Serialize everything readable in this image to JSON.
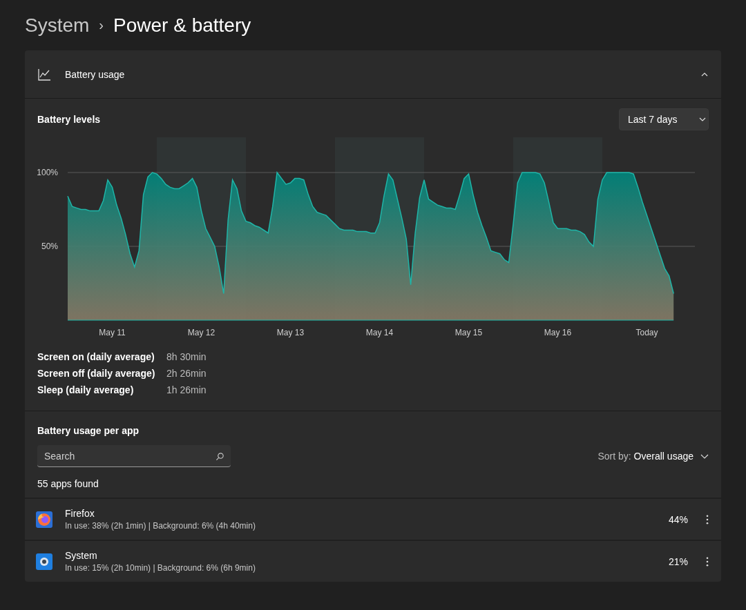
{
  "breadcrumb": {
    "parent": "System",
    "separator": "›",
    "current": "Power & battery"
  },
  "battery_usage": {
    "title": "Battery usage",
    "expanded": true,
    "levels_title": "Battery levels",
    "range_dropdown": "Last 7 days",
    "chart_data": {
      "type": "area",
      "ylim": [
        0,
        100
      ],
      "yticks": [
        {
          "value": 50,
          "label": "50%"
        },
        {
          "value": 100,
          "label": "100%"
        }
      ],
      "categories": [
        null,
        null,
        null,
        null,
        null,
        null,
        null,
        null,
        null,
        null,
        "May 11",
        null,
        null,
        null,
        null,
        null,
        null,
        null,
        null,
        null,
        null,
        null,
        null,
        null,
        null,
        null,
        null,
        null,
        null,
        null,
        "May 12",
        null,
        null,
        null,
        null,
        null,
        null,
        null,
        null,
        null,
        null,
        null,
        null,
        null,
        null,
        null,
        null,
        null,
        null,
        null,
        "May 13",
        null,
        null,
        null,
        null,
        null,
        null,
        null,
        null,
        null,
        null,
        null,
        null,
        null,
        null,
        null,
        null,
        null,
        null,
        null,
        "May 14",
        null,
        null,
        null,
        null,
        null,
        null,
        null,
        null,
        null,
        null,
        null,
        null,
        null,
        null,
        null,
        null,
        null,
        null,
        null,
        "May 15",
        null,
        null,
        null,
        null,
        null,
        null,
        null,
        null,
        null,
        null,
        null,
        null,
        null,
        null,
        null,
        null,
        null,
        null,
        null,
        "May 16",
        null,
        null,
        null,
        null,
        null,
        null,
        null,
        null,
        null,
        null,
        null,
        null,
        null,
        null,
        null,
        null,
        null,
        null,
        null,
        "Today",
        null,
        null,
        null,
        null,
        null,
        null
      ],
      "series": [
        {
          "color": "#1fb5a8",
          "values": [
            84,
            77,
            76,
            75,
            75,
            74,
            74,
            74,
            81,
            95,
            90,
            78,
            69,
            58,
            45,
            36,
            47,
            85,
            97,
            100,
            99,
            96,
            92,
            90,
            89,
            89,
            91,
            93,
            96,
            90,
            74,
            62,
            56,
            50,
            36,
            18,
            68,
            95,
            89,
            74,
            67,
            66,
            64,
            63,
            61,
            59,
            77,
            100,
            96,
            92,
            93,
            96,
            96,
            95,
            85,
            77,
            73,
            72,
            71,
            68,
            65,
            62,
            61,
            61,
            61,
            60,
            60,
            60,
            59,
            59,
            66,
            84,
            99,
            95,
            82,
            69,
            55,
            24,
            59,
            83,
            95,
            82,
            80,
            78,
            77,
            76,
            76,
            75,
            85,
            96,
            99,
            85,
            73,
            64,
            56,
            47,
            46,
            45,
            41,
            39,
            65,
            93,
            100,
            100,
            100,
            100,
            99,
            93,
            80,
            66,
            62,
            62,
            62,
            61,
            61,
            60,
            58,
            53,
            50,
            82,
            95,
            100,
            100,
            100,
            100,
            100,
            100,
            99,
            90,
            80,
            71,
            62,
            53,
            44,
            35,
            30,
            18
          ]
        }
      ]
    },
    "stats": [
      {
        "label": "Screen on (daily average)",
        "value": "8h 30min"
      },
      {
        "label": "Screen off (daily average)",
        "value": "2h 26min"
      },
      {
        "label": "Sleep (daily average)",
        "value": "1h 26min"
      }
    ]
  },
  "per_app": {
    "title": "Battery usage per app",
    "search": {
      "placeholder": "Search"
    },
    "sort_label": "Sort by:",
    "sort_value": "Overall usage",
    "count": "55 apps found",
    "apps": [
      {
        "kind": "firefox",
        "name": "Firefox",
        "detail": "In use: 38% (2h 1min) | Background: 6% (4h 40min)",
        "percent": "44%"
      },
      {
        "kind": "system",
        "name": "System",
        "detail": "In use: 15% (2h 10min) | Background: 6% (6h 9min)",
        "percent": "21%"
      }
    ]
  }
}
